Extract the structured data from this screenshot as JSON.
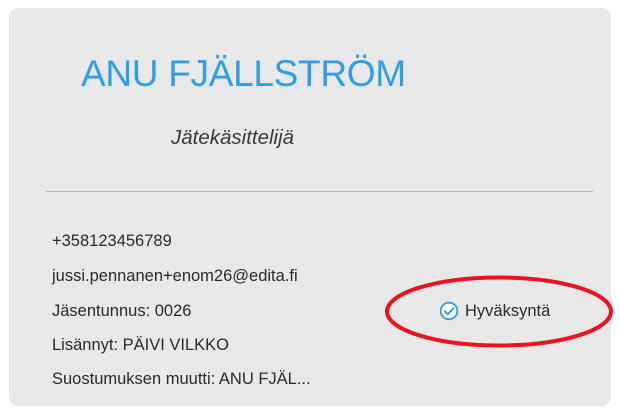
{
  "card": {
    "name": "ANU FJÄLLSTRÖM",
    "role": "Jätekäsittelijä",
    "phone": "+358123456789",
    "email": "jussi.pennanen+enom26@edita.fi",
    "member_id": "Jäsentunnus: 0026",
    "added_by": "Lisännyt: PÄIVI VILKKO",
    "consent_changed_by": "Suostumuksen muutti: ANU FJÄL...",
    "approval": {
      "label": "Hyväksyntä",
      "icon": "check-circle-icon",
      "icon_color": "#2f9ee6"
    }
  },
  "annotation": {
    "shape": "ellipse",
    "color": "#e8141e"
  }
}
